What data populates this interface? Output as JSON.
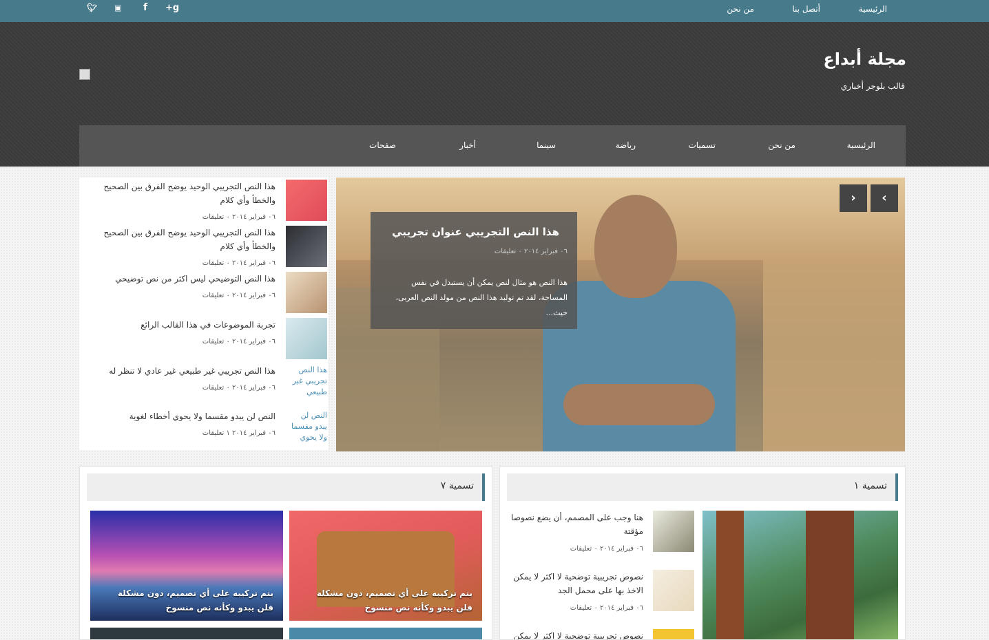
{
  "topbar": {
    "nav": [
      "الرئيسية",
      "أتصل بنا",
      "من نحن"
    ],
    "social_icons": [
      "google-plus-icon",
      "facebook-icon",
      "youtube-icon",
      "twitter-icon"
    ]
  },
  "header": {
    "title": "مجلة أبداع",
    "description": "قالب بلوجر أخباري"
  },
  "mainnav": [
    "الرئيسية",
    "من نحن",
    "تسميات",
    "رياضة",
    "سينما",
    "أخبار",
    "صفحات"
  ],
  "slider": {
    "title": "هذا النص التجريبي عنوان تجريبي",
    "meta": "٠٦ فبراير ٢٠١٤  ٠ تعليقات",
    "excerpt": "هذا النص هو مثال لنص يمكن أن يستبدل في نفس المساحة، لقد تم توليد هذا النص من مولد النص العربى، حيث...",
    "next_label": "›",
    "prev_label": "‹"
  },
  "sidelist": [
    {
      "title": "هذا النص التجريبي الوحيد يوضح الفرق بين الصحيح والخطأ وأي كلام",
      "meta": "٠٦ فبراير ٢٠١٤  ٠ تعليقات",
      "thumb_color": "#f36b6b"
    },
    {
      "title": "هذا النص التجريبي الوحيد يوضح الفرق بين الصحيح والخطأ وأي كلام",
      "meta": "٠٦ فبراير ٢٠١٤  ٠ تعليقات",
      "thumb_color": "#3e4048"
    },
    {
      "title": "هذا النص التوضيحي ليس اكثر من نص توضيحي",
      "meta": "٠٦ فبراير ٢٠١٤  ٠ تعليقات",
      "thumb_color": "#d6c2a6"
    },
    {
      "title": "تجربة الموضوعات في هذا القالب الرائع",
      "meta": "٠٦ فبراير ٢٠١٤  ٠ تعليقات",
      "thumb_color": "#c6dbe0"
    },
    {
      "title": "هذا النص تجريبي غير طبيعي غير عادي لا تنظر له",
      "meta": "٠٦ فبراير ٢٠١٤  ٠ تعليقات",
      "alt": "هذا النص تجريبي غير طبيعي"
    },
    {
      "title": "النص لن يبدو مقسما ولا يحوي أخطاء لغوية",
      "meta": "٠٦ فبراير ٢٠١٤  ١ تعليقات",
      "alt": "النص لن يبدو مقسما ولا يحوي"
    }
  ],
  "box_left": {
    "heading": "تسمية ٧",
    "tiles": [
      {
        "title": "يتم تركيبه على أي تصميم، دون مشكلة فلن يبدو وكأنه نص منسوخ",
        "color1": "#e85a5a",
        "color2": "#b8643a"
      },
      {
        "title": "يتم تركيبه على أي تصميم، دون مشكلة فلن يبدو وكأنه نص منسوخ",
        "color1": "#3a3fb0",
        "color2": "#e04a9a"
      }
    ]
  },
  "box_right": {
    "heading": "تسمية ١",
    "items": [
      {
        "title": "هنا وجب على المصمم، أن يضع نصوصا مؤقتة",
        "meta": "٠٦ فبراير ٢٠١٤  ٠ تعليقات",
        "thumb_color": "#cdd0c4"
      },
      {
        "title": "نصوص تجريبية توضحية لا اكثر لا يمكن الاخذ بها على محمل الجد",
        "meta": "٠٦ فبراير ٢٠١٤  ٠ تعليقات",
        "thumb_color": "#efe7d6"
      },
      {
        "title": "نصوص تجريبية توضحية لا اكثر لا يمكن",
        "meta": "",
        "thumb_color": "#f2c531"
      }
    ]
  },
  "colors": {
    "topbar": "#477a8b",
    "header": "#3a3a3a",
    "nav": "#555555",
    "accent": "#477a8b"
  }
}
